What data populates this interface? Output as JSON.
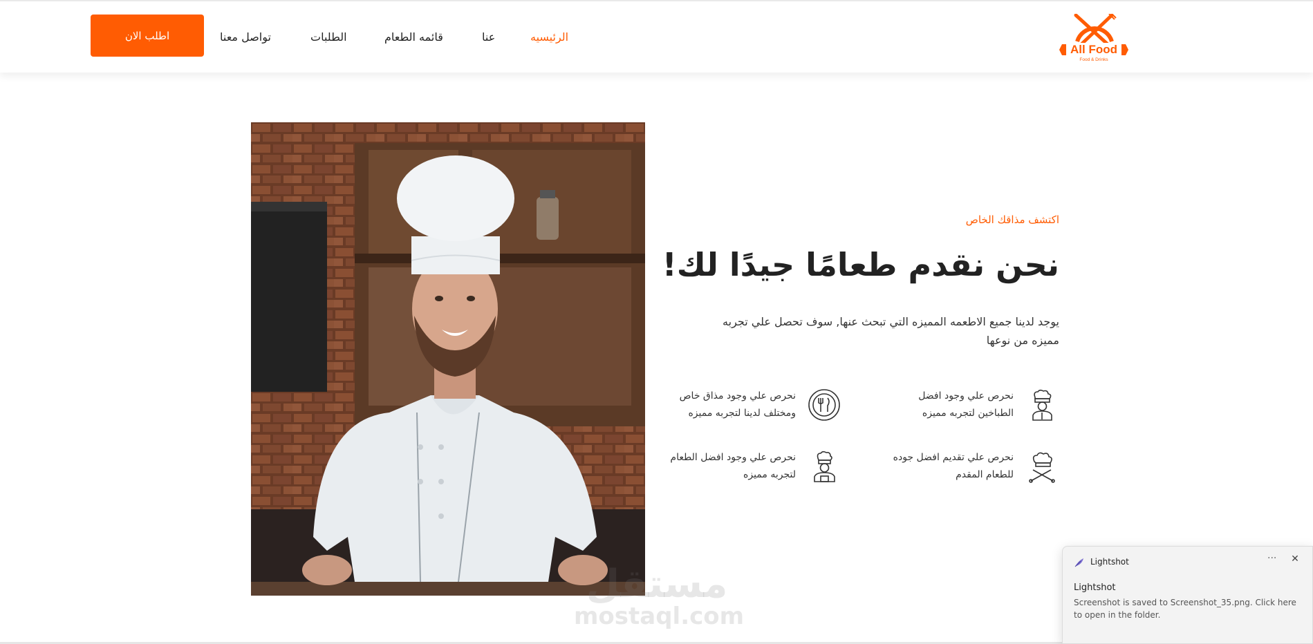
{
  "header": {
    "order_button": "اطلب الان",
    "nav": [
      {
        "label": "تواصل معنا",
        "active": false
      },
      {
        "label": "الطلبات",
        "active": false
      },
      {
        "label": "قائمه الطعام",
        "active": false
      },
      {
        "label": "عنا",
        "active": false
      },
      {
        "label": "الرئيسيه",
        "active": true
      }
    ],
    "logo": {
      "name": "All Food",
      "tagline": "Food & Drinks"
    }
  },
  "hero": {
    "eyebrow": "اكتشف مذاقك الخاص",
    "headline": "نحن نقدم طعامًا جيدًا لك!",
    "description": "يوجد لدينا جميع الاطعمه المميزه التي تبحث عنها, سوف تحصل علي تجربه مميزه من نوعها",
    "features": [
      {
        "icon": "chef-icon",
        "text": "نحرص علي وجود افضل الطباخين لتجربه مميزه"
      },
      {
        "icon": "plate-utensils-icon",
        "text": "نحرص علي وجود مذاق خاص ومختلف لدينا لتجربه مميزه"
      },
      {
        "icon": "chef-hat-utensils-icon",
        "text": "نحرص علي تقديم افضل جوده للطعام المقدم"
      },
      {
        "icon": "cook-icon",
        "text": "نحرص علي وجود افضل الطعام لتجربه مميزه"
      }
    ]
  },
  "watermark": {
    "arabic": "مستقل",
    "latin": "mostaql.com"
  },
  "notification": {
    "app": "Lightshot",
    "title": "Lightshot",
    "body": "Screenshot is saved to Screenshot_35.png. Click here to open in the folder.",
    "more": "···",
    "close": "✕"
  },
  "colors": {
    "accent": "#ff5c03",
    "text": "#222222"
  }
}
